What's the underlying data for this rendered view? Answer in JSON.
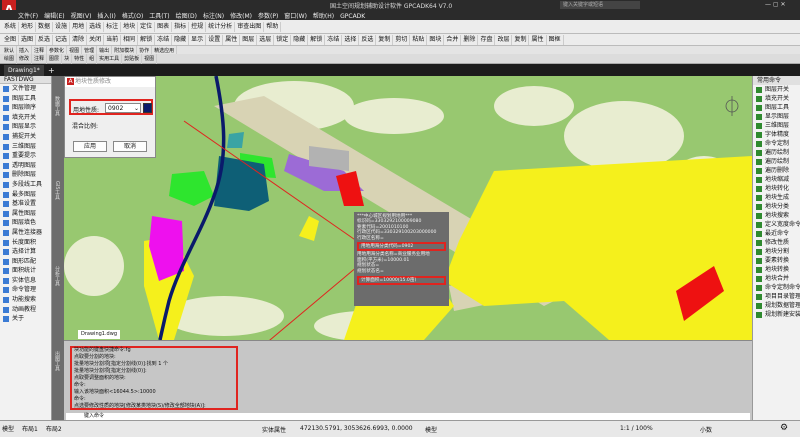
{
  "app": {
    "title": "国土空间规划辅助设计软件 GPCADK64 V7.0",
    "search_placeholder": "键入关键字或短语"
  },
  "menu": [
    "文件(F)",
    "编辑(E)",
    "视图(V)",
    "插入(I)",
    "格式(O)",
    "工具(T)",
    "绘图(D)",
    "标注(N)",
    "修改(M)",
    "参数(P)",
    "窗口(W)",
    "帮助(H)",
    "GPCADK"
  ],
  "ribbon1": [
    "系统",
    "地形",
    "数据",
    "设施",
    "用地",
    "选线",
    "标注",
    "地块",
    "定位",
    "图表",
    "指标",
    "控规",
    "统计分析",
    "审查出图",
    "帮助"
  ],
  "ribbon2": [
    "全图",
    "选图",
    "反选",
    "记选",
    "清除",
    "关闭",
    "当前",
    "相同",
    "解锁",
    "冻结",
    "隐藏",
    "显示",
    "设置",
    "属性",
    "图层",
    "选层",
    "锁定",
    "隐藏",
    "解锁",
    "冻结",
    "选择",
    "反选",
    "复制",
    "剪切",
    "粘贴",
    "图块",
    "合并",
    "删除",
    "存盘",
    "改层",
    "复制",
    "属性",
    "图框"
  ],
  "ribbon3": [
    "默认",
    "插入",
    "注释",
    "参数化",
    "视图",
    "管理",
    "输出",
    "附加模块",
    "协作",
    "精选应用"
  ],
  "ribbon4": [
    "绘图",
    "修改",
    "注释",
    "图层",
    "块",
    "特性",
    "组",
    "实用工具",
    "剪贴板",
    "视图"
  ],
  "tabs": {
    "doc": "Drawing1*",
    "plus": "+"
  },
  "left_panel": {
    "title": "FASTDWG",
    "items": [
      "文件管理",
      "图层工具",
      "图层顺序",
      "填充开关",
      "图层显示",
      "捕捉开关",
      "三维图层",
      "重要提示",
      "透明图层",
      "删除图层",
      "多段线工具",
      "最多图层",
      "基准设置",
      "属性图层",
      "图层填色",
      "属性连接器",
      "长度面积",
      "选择计算",
      "图形匹配",
      "面积统计",
      "实体信息",
      "命令管理",
      "功能搜索",
      "动画教程",
      "关于"
    ]
  },
  "side_labels": [
    "数据工具",
    "GIS工具",
    "分析工具",
    "出图工具"
  ],
  "right_panel": {
    "title": "常用命令",
    "items": [
      "图层开关",
      "填充开关",
      "图层工具",
      "显示图层",
      "三维图层",
      "字体精度",
      "命令定制",
      "遍历绘制",
      "遍历绘制",
      "遍历删除",
      "地块缩减",
      "地块转化",
      "地块生成",
      "地块分类",
      "地块搜索",
      "定义宽度命令",
      "最近命令",
      "修改性质",
      "地块分割",
      "要素转换",
      "地块转换",
      "地块合并",
      "命令定制命令",
      "项目目录管理",
      "规划数据管理",
      "规划新建安装"
    ]
  },
  "dialog": {
    "title": "地块性质修改",
    "label_code": "用地性质:",
    "code_value": "0902",
    "label_mix": "混合比例:",
    "ok": "应用",
    "cancel": "取消"
  },
  "map_tooltip": {
    "header": "***中心城区规划用地用***",
    "lines": [
      "标识码=3303292100009080",
      "要素代码=2001010100",
      "行政区代码=330329100203000000",
      "行政区名称="
    ],
    "highlight1": "用地用海分类代码=0902",
    "lines2": [
      "用地用海分类名称=商业服务业用地",
      "面积(平方米)=10000.01",
      "规划状态=",
      "规划状态名="
    ],
    "highlight2": "计算面积=10000(15.0亩)"
  },
  "canvas_tab": "Drawing1.dwg",
  "command": {
    "lines": [
      "  块功能的键盘快捷命令:fg",
      "点取要分割的地块:",
      "批量地块分割项[指定分割线(0)]:找到 1 个",
      "批量地块分割项[指定分割线(0)]:",
      "点取要调整面积的地块:",
      "命令:",
      "输入该地块面积<16044.5>:10000",
      "命令:",
      "点选要修改性质的地块[修改某类地块(S)/修改全部地块(A)]:"
    ],
    "input_placeholder": "键入命令"
  },
  "status": {
    "coords": "472130.5791, 3053626.6993, 0.0000",
    "mode": "模型",
    "scale": "1:1 / 100%",
    "units": "小数",
    "tabs": [
      "模型",
      "布局1",
      "布局2"
    ],
    "label": "实体属性"
  },
  "colors": {
    "accent": "#e0241f",
    "map_bg": "#98c870",
    "yellow": "#f5f01c",
    "navy": "#0a1a6b",
    "teal": "#0e5f76",
    "magenta": "#ee10ee"
  }
}
